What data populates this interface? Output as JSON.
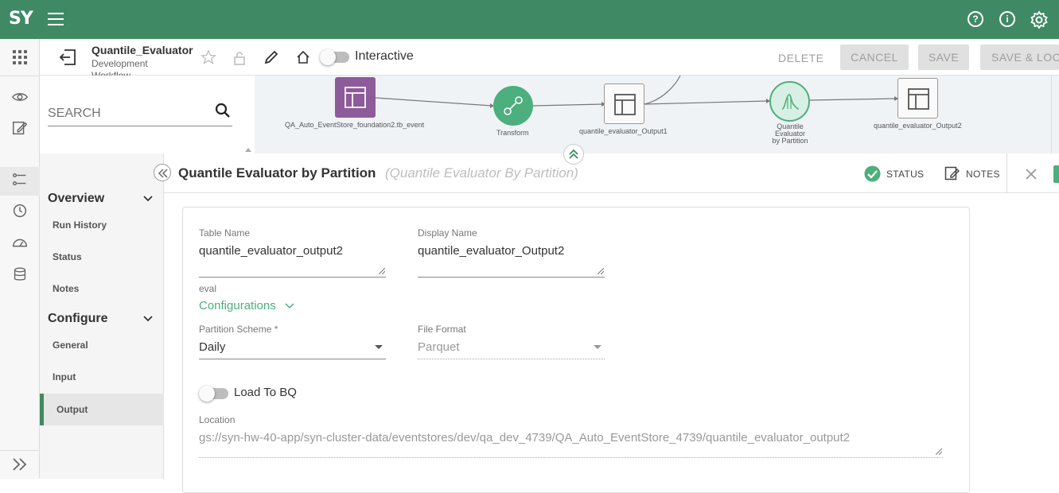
{
  "topbar": {
    "logo": "SY",
    "icons": [
      "help-icon",
      "info-icon",
      "settings-icon"
    ]
  },
  "header": {
    "workflow_title": "Quantile_Evaluator",
    "workflow_subtitle": "Development Workflow",
    "interactive_label": "Interactive",
    "delete_label": "DELETE",
    "cancel_label": "CANCEL",
    "save_label": "SAVE",
    "save_lock_label": "SAVE & LOCK"
  },
  "search": {
    "placeholder": "SEARCH"
  },
  "canvas": {
    "nodes": [
      {
        "label": "QA_Auto_EventStore_foundation2.tb_event"
      },
      {
        "label": "Transform"
      },
      {
        "label": "quantile_evaluator_Output1"
      },
      {
        "label": "Quantile Evaluator by Partition"
      },
      {
        "label": "quantile_evaluator_Output2"
      }
    ]
  },
  "sidebar": {
    "overview": "Overview",
    "overview_items": [
      "Run History",
      "Status",
      "Notes"
    ],
    "configure": "Configure",
    "configure_items": [
      "General",
      "Input",
      "Output"
    ]
  },
  "panel": {
    "title": "Quantile Evaluator by Partition",
    "subtitle": "(Quantile Evaluator By Partition)",
    "status_label": "STATUS",
    "notes_label": "NOTES"
  },
  "form": {
    "table_name_label": "Table Name",
    "table_name_value": "quantile_evaluator_output2",
    "display_name_label": "Display Name",
    "display_name_value": "quantile_evaluator_Output2",
    "eval_label": "eval",
    "configurations_label": "Configurations",
    "partition_label": "Partition Scheme *",
    "partition_value": "Daily",
    "file_format_label": "File Format",
    "file_format_value": "Parquet",
    "load_bq_label": "Load To BQ",
    "location_label": "Location",
    "location_value": "gs://syn-hw-40-app/syn-cluster-data/eventstores/dev/qa_dev_4739/QA_Auto_EventStore_4739/quantile_evaluator_output2"
  },
  "colors": {
    "brand": "#3f8a64",
    "accent": "#4caf7d",
    "node_purple": "#8e5b9a"
  }
}
